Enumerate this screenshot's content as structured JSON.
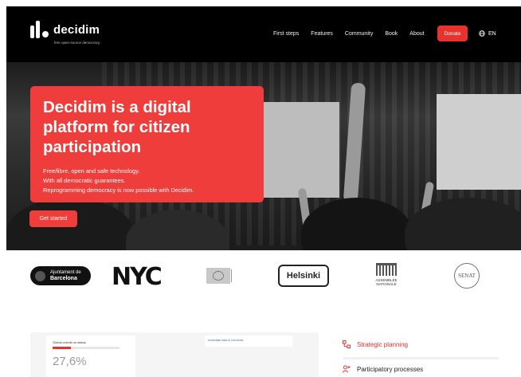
{
  "brand": {
    "name": "decidim",
    "tagline": "free open-source democracy"
  },
  "nav": {
    "links": [
      "First steps",
      "Features",
      "Community",
      "Book",
      "About"
    ],
    "donate_label": "Donate",
    "language": "EN"
  },
  "hero": {
    "title": "Decidim is a digital platform for citizen participation",
    "lines": [
      "Free/libre, open and safe technology.",
      "With all democratic guarantees.",
      "Reprogramming democracy is now possible with Decidim."
    ],
    "cta_label": "Get started"
  },
  "partners": {
    "barcelona_line1": "Ajuntament de",
    "barcelona_line2": "Barcelona",
    "nyc": "NYC",
    "helsinki": "Helsinki",
    "assemblee_line1": "ASSEMBLÉE",
    "assemblee_line2": "NATIONALE",
    "senat": "SENAT"
  },
  "dashboard": {
    "stat_label": "Global overall on status",
    "stat_value": "27,6%",
    "stat_progress": 0.276,
    "mini_label": "Immediate data in 1st format"
  },
  "sidebar": {
    "items": [
      {
        "label": "Strategic planning",
        "icon": "strategy-icon",
        "color": "#e8322d"
      },
      {
        "label": "Participatory processes",
        "icon": "people-icon",
        "color": "#e8322d"
      }
    ]
  },
  "colors": {
    "accent": "#e8322d",
    "hero_card": "#ee3d3a",
    "nav_bg": "#000000"
  }
}
